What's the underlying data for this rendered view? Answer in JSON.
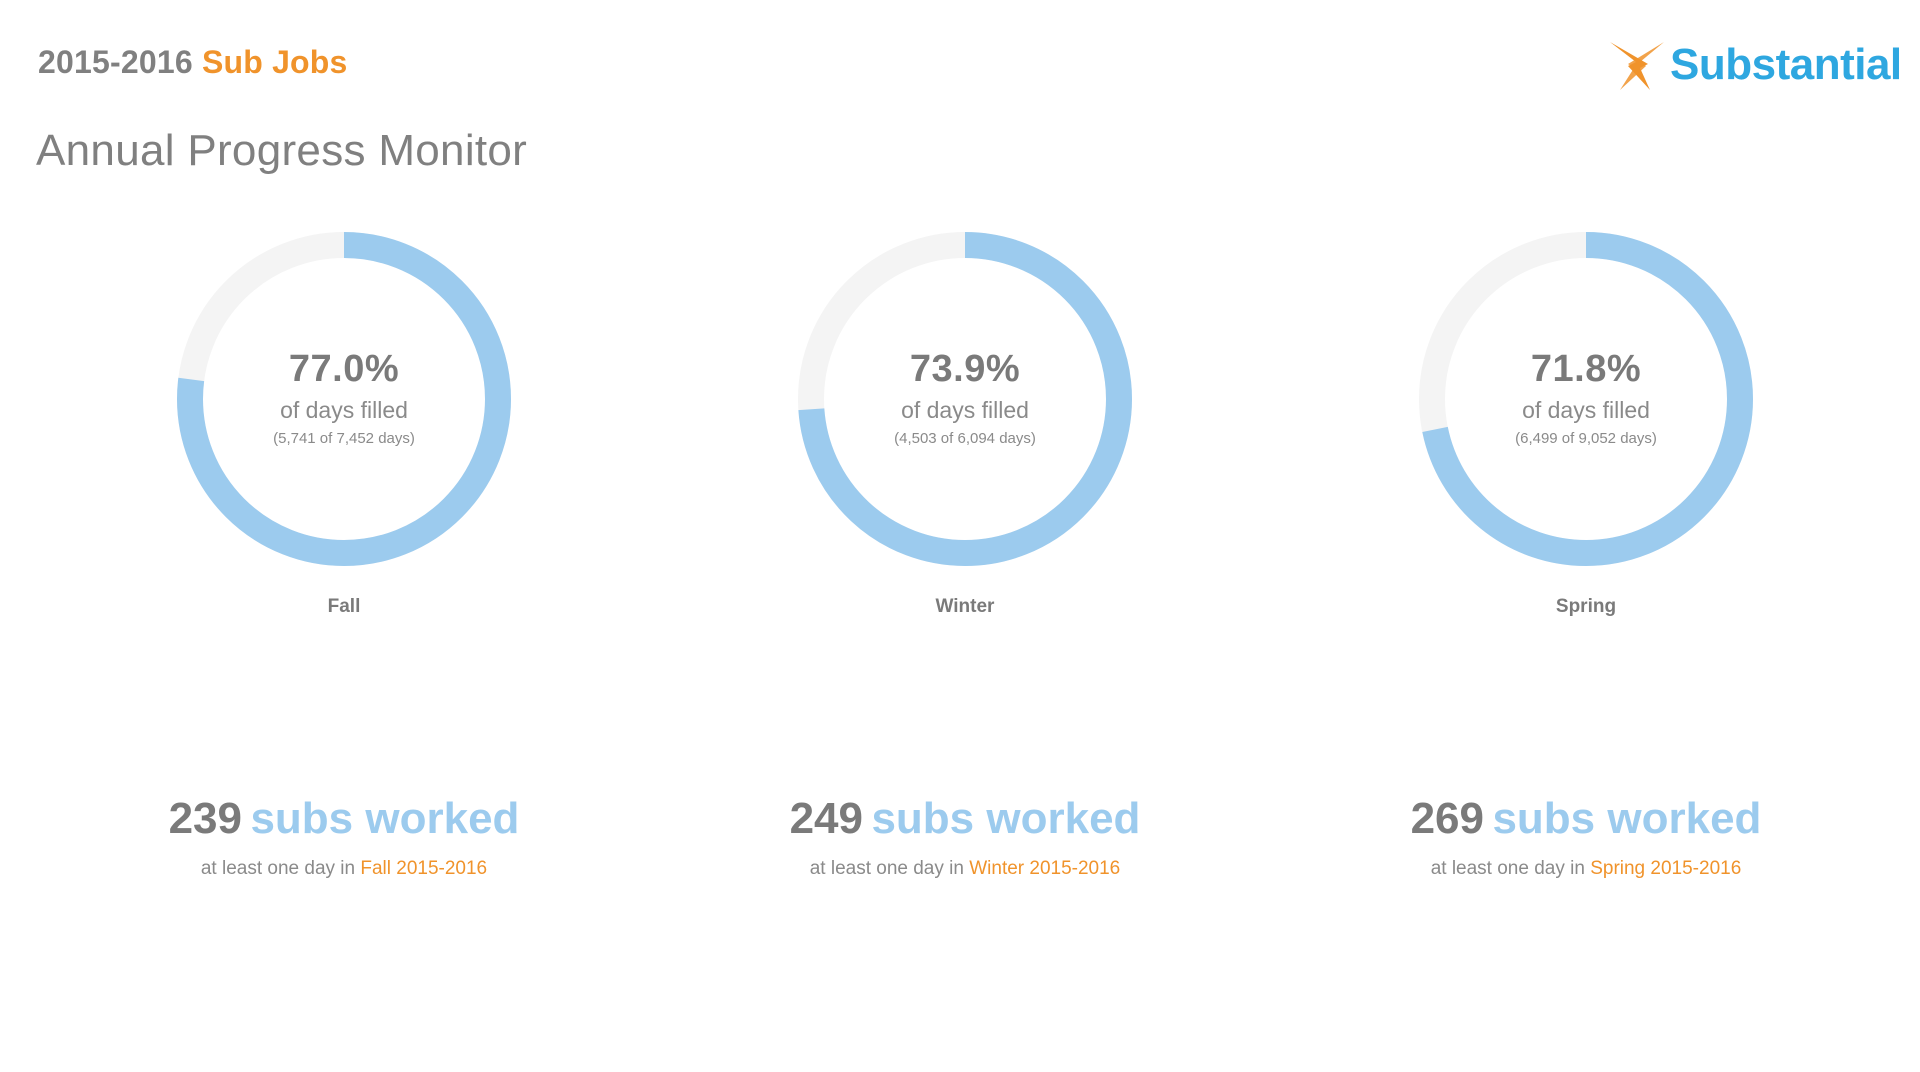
{
  "header": {
    "year": "2015-2016",
    "title_accent": "Sub Jobs",
    "logo_text": "Substantial"
  },
  "page": {
    "title": "Annual Progress Monitor"
  },
  "colors": {
    "ring_fill": "#9ccbee",
    "ring_track": "#f4f4f4",
    "accent_orange": "#f0932b",
    "logo_blue": "#2ea7e0",
    "text_gray": "#7a7a7a"
  },
  "chart_data": [
    {
      "type": "pie",
      "name": "Fall",
      "value": 77.0,
      "percent_label": "77.0%",
      "label": "of days filled",
      "detail": "(5,741 of 7,452 days)",
      "filled": 5741,
      "total": 7452
    },
    {
      "type": "pie",
      "name": "Winter",
      "value": 73.9,
      "percent_label": "73.9%",
      "label": "of days filled",
      "detail": "(4,503 of 6,094 days)",
      "filled": 4503,
      "total": 6094
    },
    {
      "type": "pie",
      "name": "Spring",
      "value": 71.8,
      "percent_label": "71.8%",
      "label": "of days filled",
      "detail": "(6,499 of 9,052 days)",
      "filled": 6499,
      "total": 9052
    }
  ],
  "subs": [
    {
      "count": "239",
      "text": "subs worked",
      "prefix": "at least one day in",
      "period": "Fall 2015-2016"
    },
    {
      "count": "249",
      "text": "subs worked",
      "prefix": "at least one day in",
      "period": "Winter 2015-2016"
    },
    {
      "count": "269",
      "text": "subs worked",
      "prefix": "at least one day in",
      "period": "Spring 2015-2016"
    }
  ]
}
